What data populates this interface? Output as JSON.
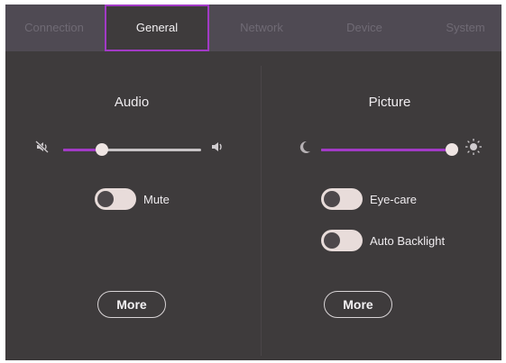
{
  "tabs": [
    {
      "label": "Connection",
      "active": false
    },
    {
      "label": "General",
      "active": true
    },
    {
      "label": "Network",
      "active": false
    },
    {
      "label": "Device",
      "active": false
    },
    {
      "label": "System",
      "active": false
    }
  ],
  "audio": {
    "heading": "Audio",
    "volume_level": 0.28,
    "mute_label": "Mute",
    "mute_on": false,
    "more_label": "More",
    "icons": [
      "speaker-muted-icon",
      "speaker-icon"
    ]
  },
  "picture": {
    "heading": "Picture",
    "brightness_level": 1.0,
    "eye_care_label": "Eye-care",
    "eye_care_on": false,
    "auto_backlight_label": "Auto Backlight",
    "auto_backlight_on": false,
    "more_label": "More",
    "icons": [
      "moon-icon",
      "sun-icon"
    ]
  },
  "colors": {
    "accent": "#a23ac6",
    "background": "#3e3b3c",
    "tabbar": "#4f4a53"
  }
}
